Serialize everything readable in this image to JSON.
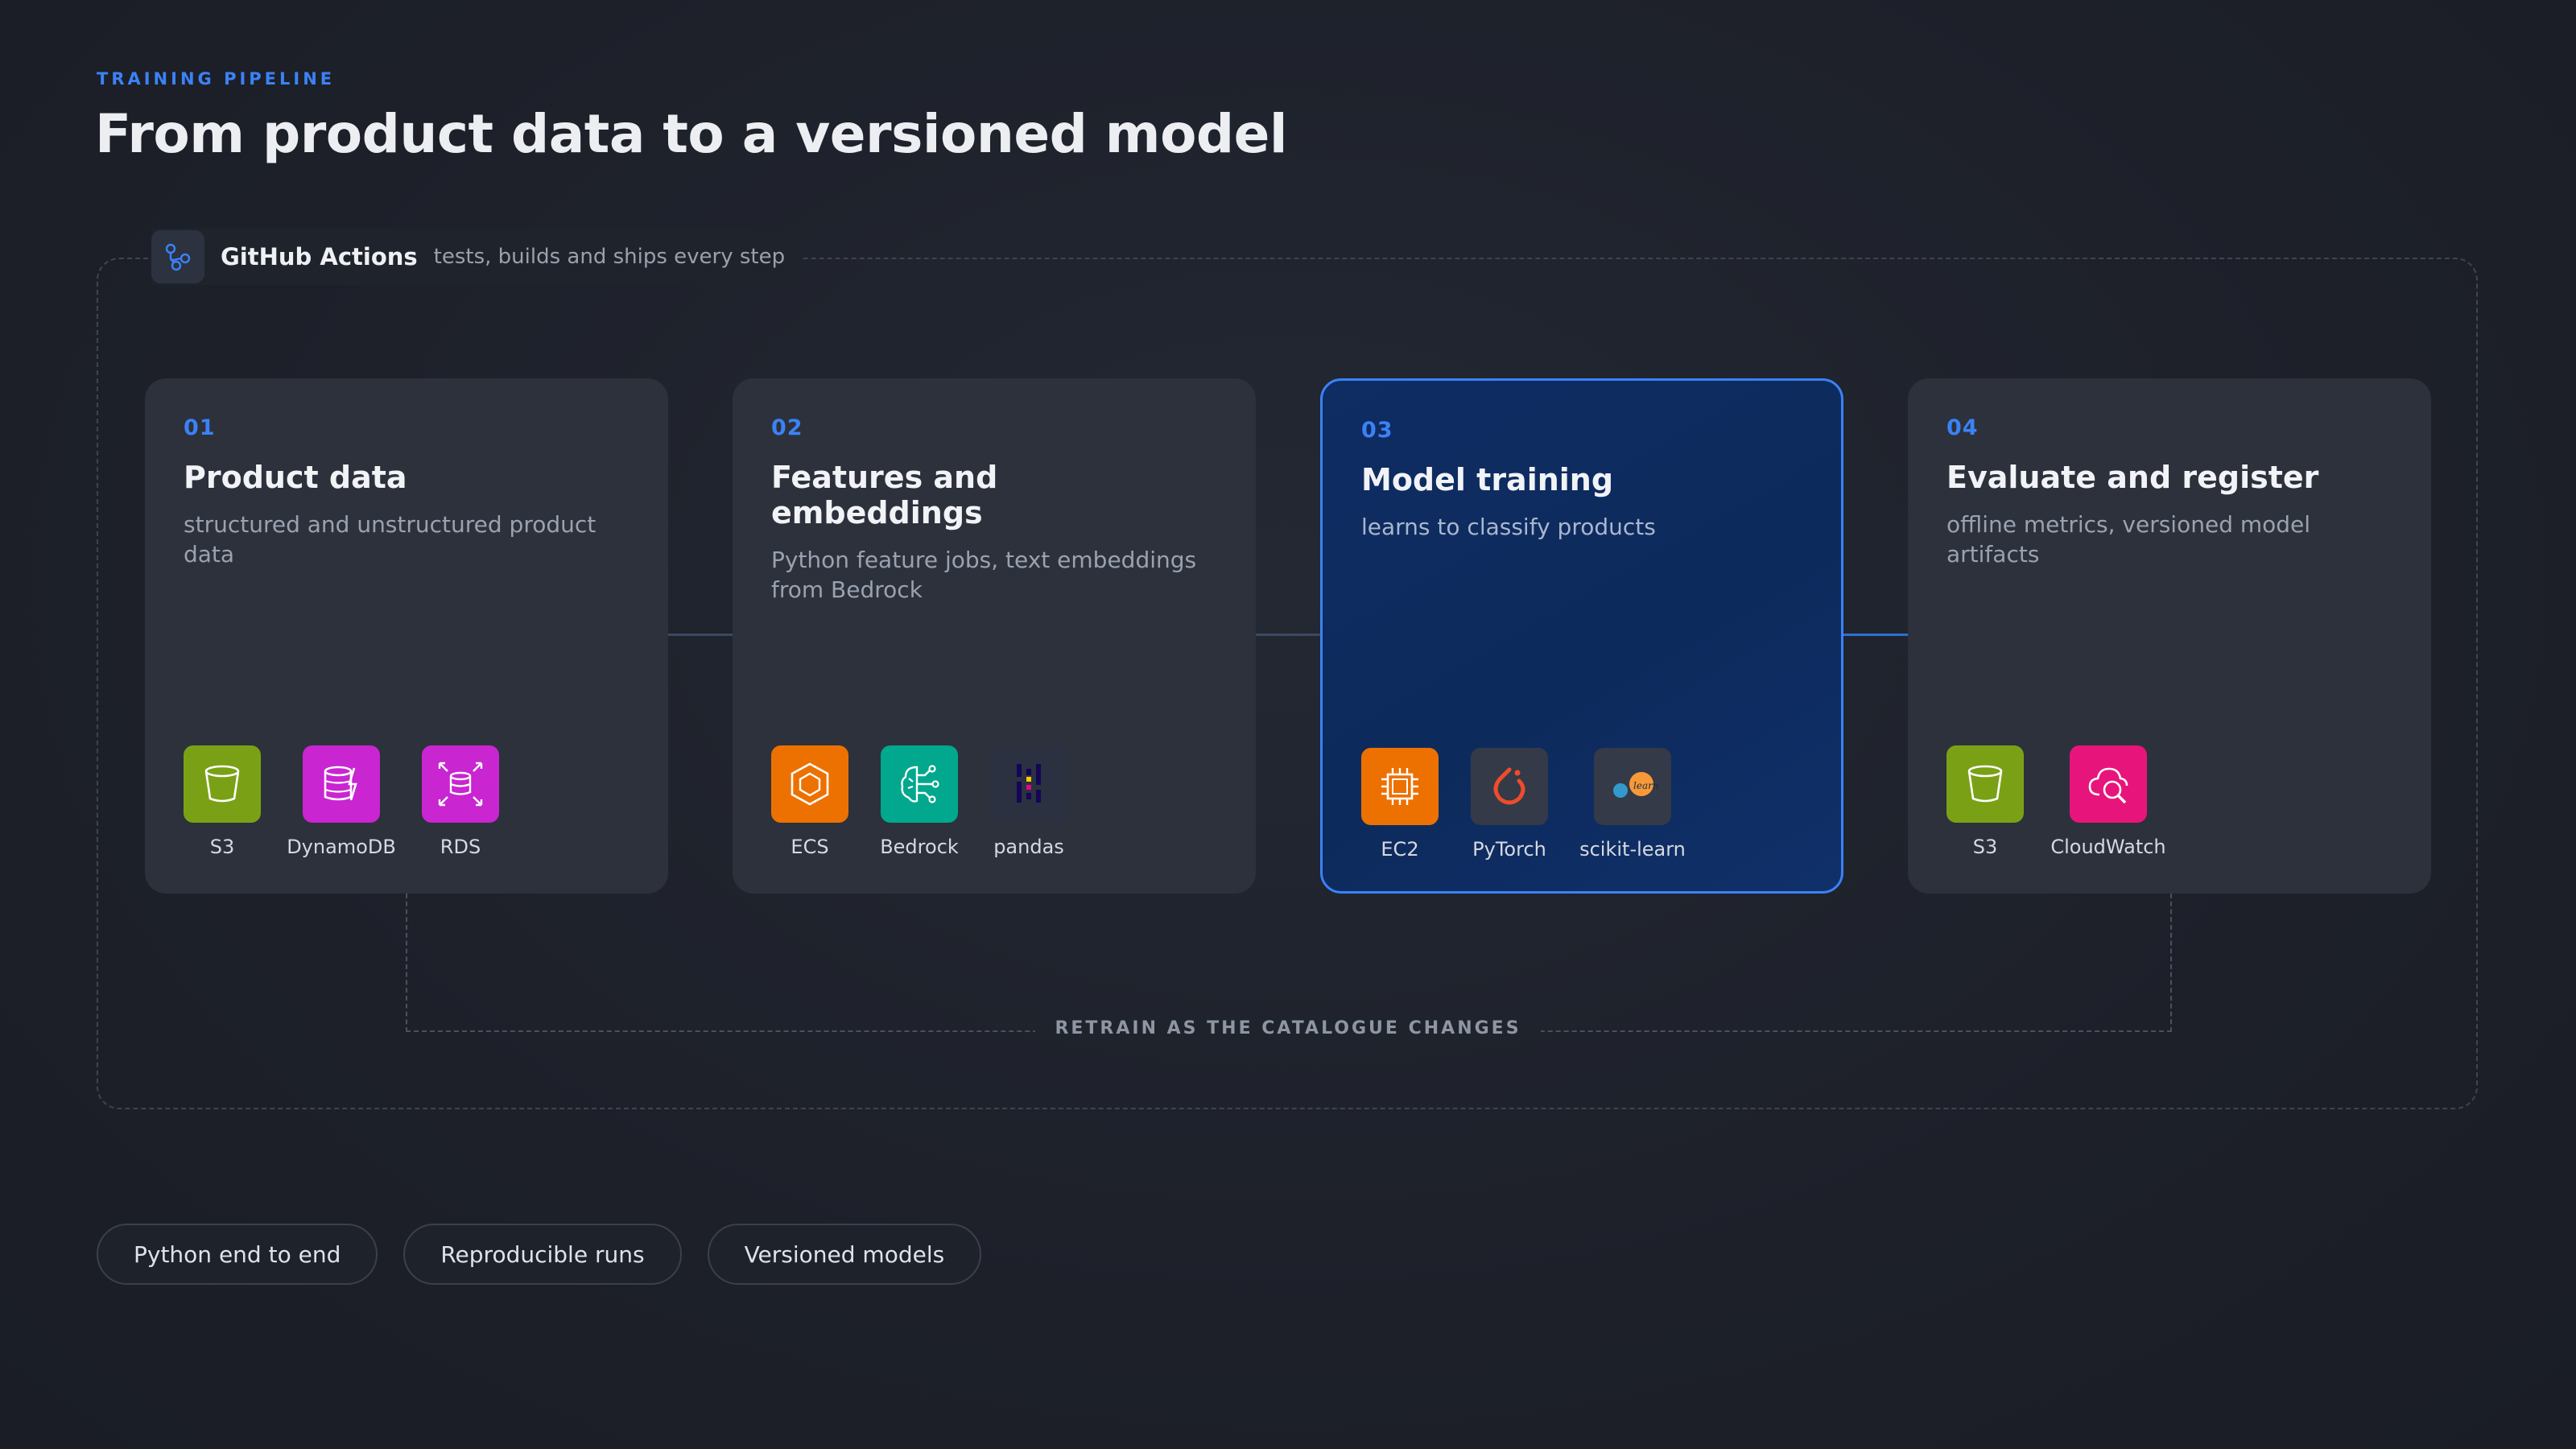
{
  "header": {
    "eyebrow": "TRAINING PIPELINE",
    "title": "From product data to a versioned model"
  },
  "ci": {
    "name": "GitHub Actions",
    "description": "tests, builds and ships every step",
    "icon": "github-actions-icon"
  },
  "stages": [
    {
      "number": "01",
      "title": "Product data",
      "description": "structured and unstructured product data",
      "tools": [
        {
          "label": "S3",
          "icon": "s3-bucket-icon",
          "color": "#7aa116"
        },
        {
          "label": "DynamoDB",
          "icon": "dynamodb-icon",
          "color": "#c925d1"
        },
        {
          "label": "RDS",
          "icon": "rds-icon",
          "color": "#c925d1"
        }
      ]
    },
    {
      "number": "02",
      "title": "Features and embeddings",
      "description": "Python feature jobs, text embeddings from Bedrock",
      "tools": [
        {
          "label": "ECS",
          "icon": "ecs-icon",
          "color": "#ed7100"
        },
        {
          "label": "Bedrock",
          "icon": "bedrock-icon",
          "color": "#01a88d"
        },
        {
          "label": "pandas",
          "icon": "pandas-icon",
          "color": "#2b3140"
        }
      ]
    },
    {
      "number": "03",
      "title": "Model training",
      "description": "learns to classify products",
      "active": true,
      "tools": [
        {
          "label": "EC2",
          "icon": "ec2-icon",
          "color": "#ed7100"
        },
        {
          "label": "PyTorch",
          "icon": "pytorch-icon",
          "color": "#343a47"
        },
        {
          "label": "scikit-learn",
          "icon": "scikit-learn-icon",
          "color": "#343a47"
        }
      ]
    },
    {
      "number": "04",
      "title": "Evaluate and register",
      "description": "offline metrics, versioned model artifacts",
      "tools": [
        {
          "label": "S3",
          "icon": "s3-bucket-icon",
          "color": "#7aa116"
        },
        {
          "label": "CloudWatch",
          "icon": "cloudwatch-icon",
          "color": "#e7157b"
        }
      ]
    }
  ],
  "loop_label": "RETRAIN AS THE CATALOGUE CHANGES",
  "pills": [
    "Python end to end",
    "Reproducible runs",
    "Versioned models"
  ],
  "colors": {
    "accent": "#3b82f6",
    "card": "#2c313c",
    "active_card": "#0f2d63"
  }
}
